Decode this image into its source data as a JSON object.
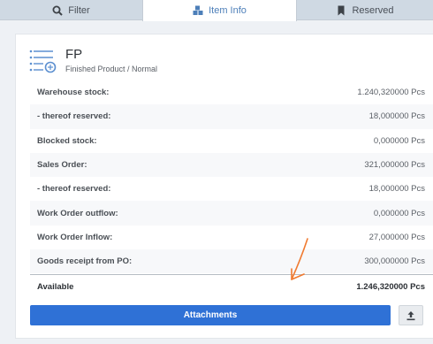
{
  "tabs": [
    {
      "label": "Filter",
      "icon": "search-icon"
    },
    {
      "label": "Item Info",
      "icon": "cubes-icon",
      "active": true
    },
    {
      "label": "Reserved",
      "icon": "bookmark-icon"
    }
  ],
  "item": {
    "code": "FP",
    "subtitle": "Finished Product / Normal",
    "icon": "list-search-icon"
  },
  "stock_rows": [
    {
      "label": "Warehouse stock:",
      "value": "1.240,320000 Pcs"
    },
    {
      "label": "- thereof reserved:",
      "value": "18,000000 Pcs"
    },
    {
      "label": "Blocked stock:",
      "value": "0,000000 Pcs"
    },
    {
      "label": "Sales Order:",
      "value": "321,000000 Pcs"
    },
    {
      "label": "- thereof reserved:",
      "value": "18,000000 Pcs"
    },
    {
      "label": "Work Order outflow:",
      "value": "0,000000 Pcs"
    },
    {
      "label": "Work Order Inflow:",
      "value": "27,000000 Pcs"
    },
    {
      "label": "Goods receipt from PO:",
      "value": "300,000000 Pcs"
    }
  ],
  "total": {
    "label": "Available",
    "value": "1.246,320000 Pcs"
  },
  "actions": {
    "attachments_label": "Attachments",
    "upload_icon": "upload-icon"
  },
  "colors": {
    "primary": "#2f71d6",
    "tab_bar": "#cfd9e3",
    "active_tab_text": "#4d7fb9",
    "annotation_arrow": "#f07a30"
  }
}
